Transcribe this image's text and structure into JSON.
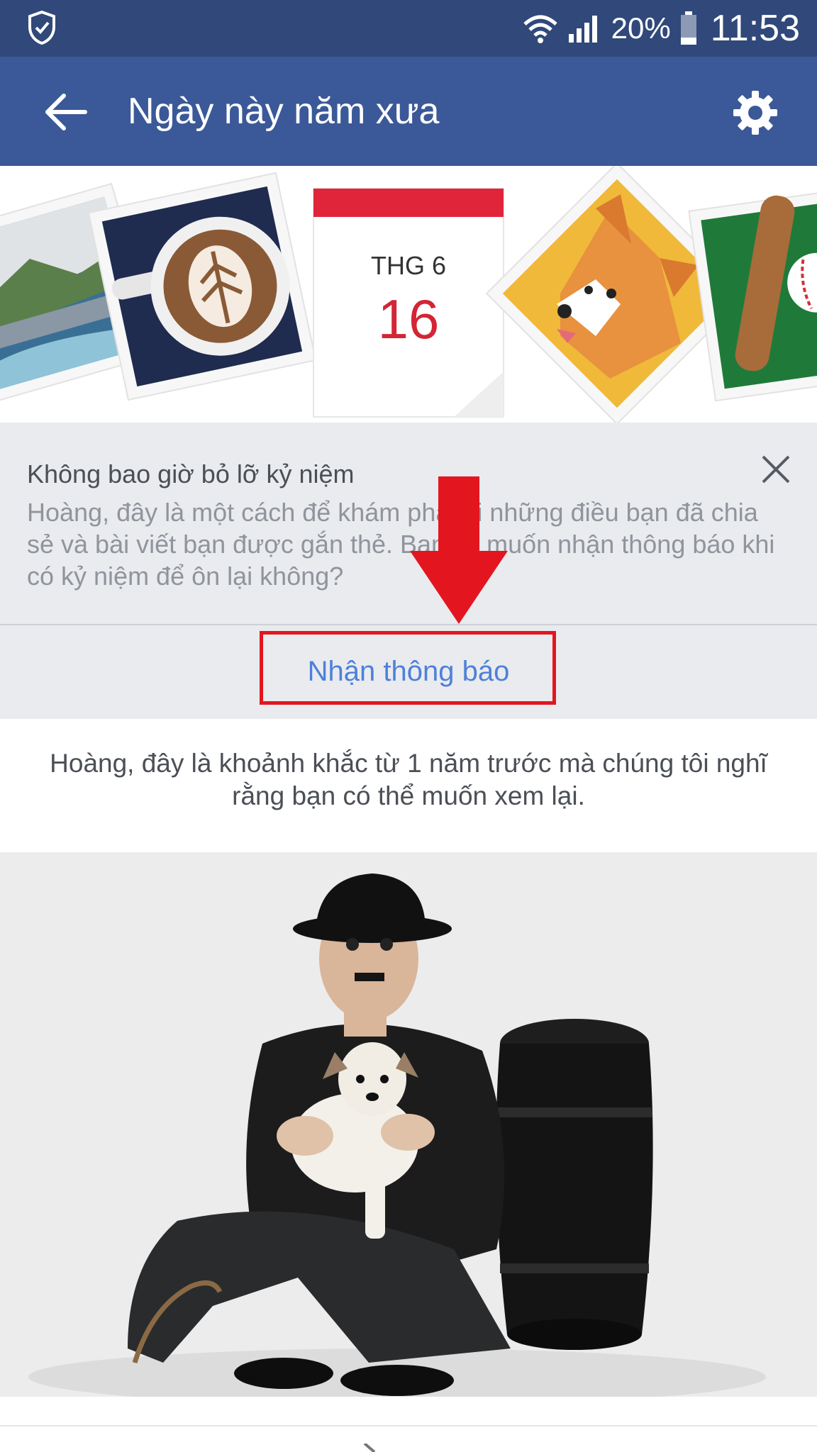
{
  "status_bar": {
    "battery_percent": "20%",
    "time": "11:53"
  },
  "app_bar": {
    "title": "Ngày này năm xưa"
  },
  "banner": {
    "calendar_month": "THG 6",
    "calendar_day": "16"
  },
  "tip_card": {
    "title": "Không bao giờ bỏ lỡ kỷ niệm",
    "body": "Hoàng, đây là một cách để khám phá lại những điều bạn đã chia sẻ và bài viết bạn được gắn thẻ. Bạn có muốn nhận thông báo khi có kỷ niệm để ôn lại không?",
    "action_label": "Nhận thông báo"
  },
  "memory": {
    "intro_text": "Hoàng, đây là khoảnh khắc từ 1 năm trước mà chúng tôi nghĩ rằng bạn có thể muốn xem lại."
  },
  "colors": {
    "status_bar": "#30487a",
    "app_bar": "#3b5998",
    "panel": "#e9ebee",
    "link": "#4f80d9",
    "highlight": "#e3161f"
  }
}
